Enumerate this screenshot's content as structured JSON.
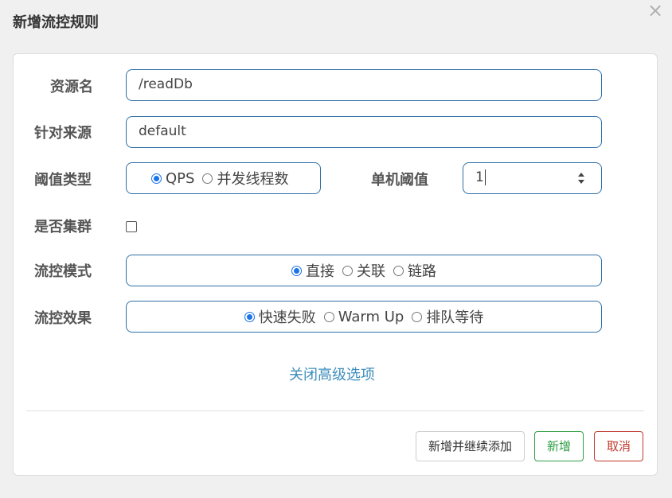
{
  "dialog": {
    "title": "新增流控规则"
  },
  "form": {
    "resource_name": {
      "label": "资源名",
      "value": "/readDb"
    },
    "limit_app": {
      "label": "针对来源",
      "value": "default"
    },
    "threshold_type": {
      "label": "阈值类型",
      "options": [
        "QPS",
        "并发线程数"
      ],
      "selected": "QPS"
    },
    "single_threshold": {
      "label": "单机阈值",
      "value": "1"
    },
    "cluster": {
      "label": "是否集群",
      "checked": false
    },
    "flow_mode": {
      "label": "流控模式",
      "options": [
        "直接",
        "关联",
        "链路"
      ],
      "selected": "直接"
    },
    "control_effect": {
      "label": "流控效果",
      "options": [
        "快速失败",
        "Warm Up",
        "排队等待"
      ],
      "selected": "快速失败"
    },
    "advanced_toggle": "关闭高级选项"
  },
  "footer": {
    "add_continue": "新增并继续添加",
    "add": "新增",
    "cancel": "取消"
  },
  "icons": {
    "close": "close-icon",
    "stepper": "stepper-arrows-icon"
  },
  "colors": {
    "field_border": "#2f6fa8",
    "link": "#3c8dbc",
    "success": "#2f9e44",
    "danger": "#c0392b",
    "radio_checked": "#1a73e8"
  }
}
